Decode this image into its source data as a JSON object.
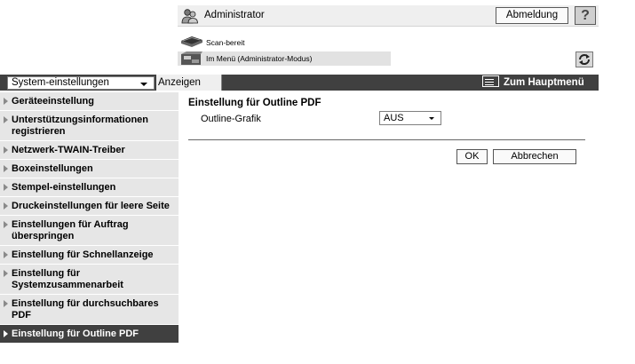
{
  "header": {
    "user_name": "Administrator",
    "logout_label": "Abmeldung",
    "help_label": "?",
    "status_scan": "Scan-bereit",
    "status_mode": "Im Menü (Administrator-Modus)",
    "refresh_icon": "refresh-icon"
  },
  "navbar": {
    "system_select_value": "System-einstellungen",
    "tab_label": "Anzeigen",
    "main_menu_label": "Zum Hauptmenü"
  },
  "sidebar": {
    "items": [
      {
        "label": "Geräteeinstellung"
      },
      {
        "label": "Unterstützungsinformationen registrieren"
      },
      {
        "label": "Netzwerk-TWAIN-Treiber"
      },
      {
        "label": "Boxeinstellungen"
      },
      {
        "label": "Stempel-einstellungen"
      },
      {
        "label": "Druckeinstellungen für leere Seite"
      },
      {
        "label": "Einstellungen für Auftrag überspringen"
      },
      {
        "label": "Einstellung für Schnellanzeige"
      },
      {
        "label": "Einstellung für Systemzusammenarbeit"
      },
      {
        "label": "Einstellung für durchsuchbares PDF"
      },
      {
        "label": "Einstellung für Outline PDF",
        "active": true
      }
    ]
  },
  "content": {
    "title": "Einstellung für Outline PDF",
    "field_label": "Outline-Grafik",
    "field_value": "AUS",
    "ok_label": "OK",
    "cancel_label": "Abbrechen"
  },
  "colors": {
    "nav_dark": "#404040",
    "sidebar_bg": "#e6e6e6",
    "header_bg": "#efefef"
  }
}
